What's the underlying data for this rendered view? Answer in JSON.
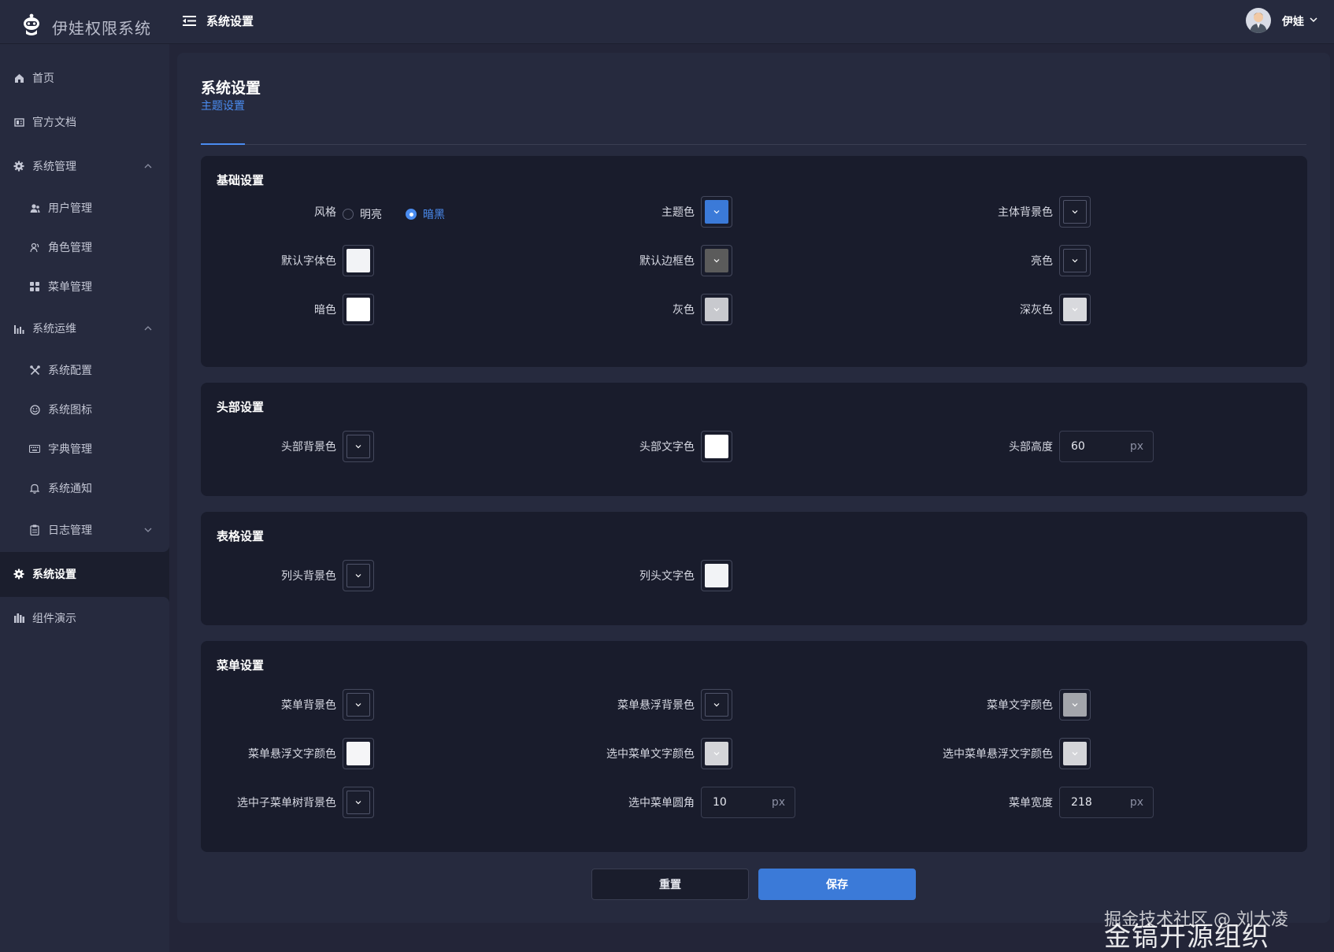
{
  "app": {
    "title": "伊娃权限系统"
  },
  "header": {
    "title": "系统设置",
    "username": "伊娃"
  },
  "sidebar": {
    "items": [
      {
        "label": "首页",
        "icon": "home-icon"
      },
      {
        "label": "官方文档",
        "icon": "document-icon"
      },
      {
        "label": "系统管理",
        "icon": "gear-icon",
        "expanded": true
      },
      {
        "label": "用户管理",
        "icon": "users-icon"
      },
      {
        "label": "角色管理",
        "icon": "role-icon"
      },
      {
        "label": "菜单管理",
        "icon": "grid-icon"
      },
      {
        "label": "系统运维",
        "icon": "bar-chart-icon",
        "expanded": true
      },
      {
        "label": "系统配置",
        "icon": "tools-icon"
      },
      {
        "label": "系统图标",
        "icon": "smile-icon"
      },
      {
        "label": "字典管理",
        "icon": "keyboard-icon"
      },
      {
        "label": "系统通知",
        "icon": "bell-icon"
      },
      {
        "label": "日志管理",
        "icon": "clipboard-icon",
        "expanded": false
      },
      {
        "label": "系统设置",
        "icon": "gear-icon",
        "active": true
      },
      {
        "label": "组件演示",
        "icon": "components-icon"
      }
    ]
  },
  "page": {
    "title": "系统设置",
    "tabs": [
      {
        "label": "主题设置",
        "active": true
      }
    ]
  },
  "basic": {
    "title": "基础设置",
    "style_label": "风格",
    "style_options": [
      "明亮",
      "暗黑"
    ],
    "style_selected": "暗黑",
    "theme_color": "主题色",
    "body_bg": "主体背景色",
    "default_font": "默认字体色",
    "default_border": "默认边框色",
    "light": "亮色",
    "dark": "暗色",
    "gray": "灰色",
    "dark_gray": "深灰色"
  },
  "head": {
    "title": "头部设置",
    "bg": "头部背景色",
    "text": "头部文字色",
    "height_label": "头部高度",
    "height_value": "60",
    "unit": "px"
  },
  "table": {
    "title": "表格设置",
    "header_bg": "列头背景色",
    "header_text": "列头文字色"
  },
  "menu": {
    "title": "菜单设置",
    "bg": "菜单背景色",
    "hover_bg": "菜单悬浮背景色",
    "text": "菜单文字颜色",
    "hover_text": "菜单悬浮文字颜色",
    "active_text": "选中菜单文字颜色",
    "active_hover_text": "选中菜单悬浮文字颜色",
    "active_sub_bg": "选中子菜单树背景色",
    "radius_label": "选中菜单圆角",
    "radius_value": "10",
    "width_label": "菜单宽度",
    "width_value": "218",
    "unit": "px"
  },
  "actions": {
    "reset": "重置",
    "save": "保存"
  },
  "watermark": {
    "line1": "掘金技术社区 @ 刘大凌",
    "line2": "金镐开源组织"
  },
  "colors": {
    "accent": "#4a8cf0",
    "theme": "#3b7ad8",
    "swatch_white": "#ffffff",
    "swatch_light": "#f2f3f6",
    "swatch_gray": "#c8c9ce",
    "swatch_border": "#5b5b5b",
    "swatch_dark": "#1a1d2c"
  }
}
